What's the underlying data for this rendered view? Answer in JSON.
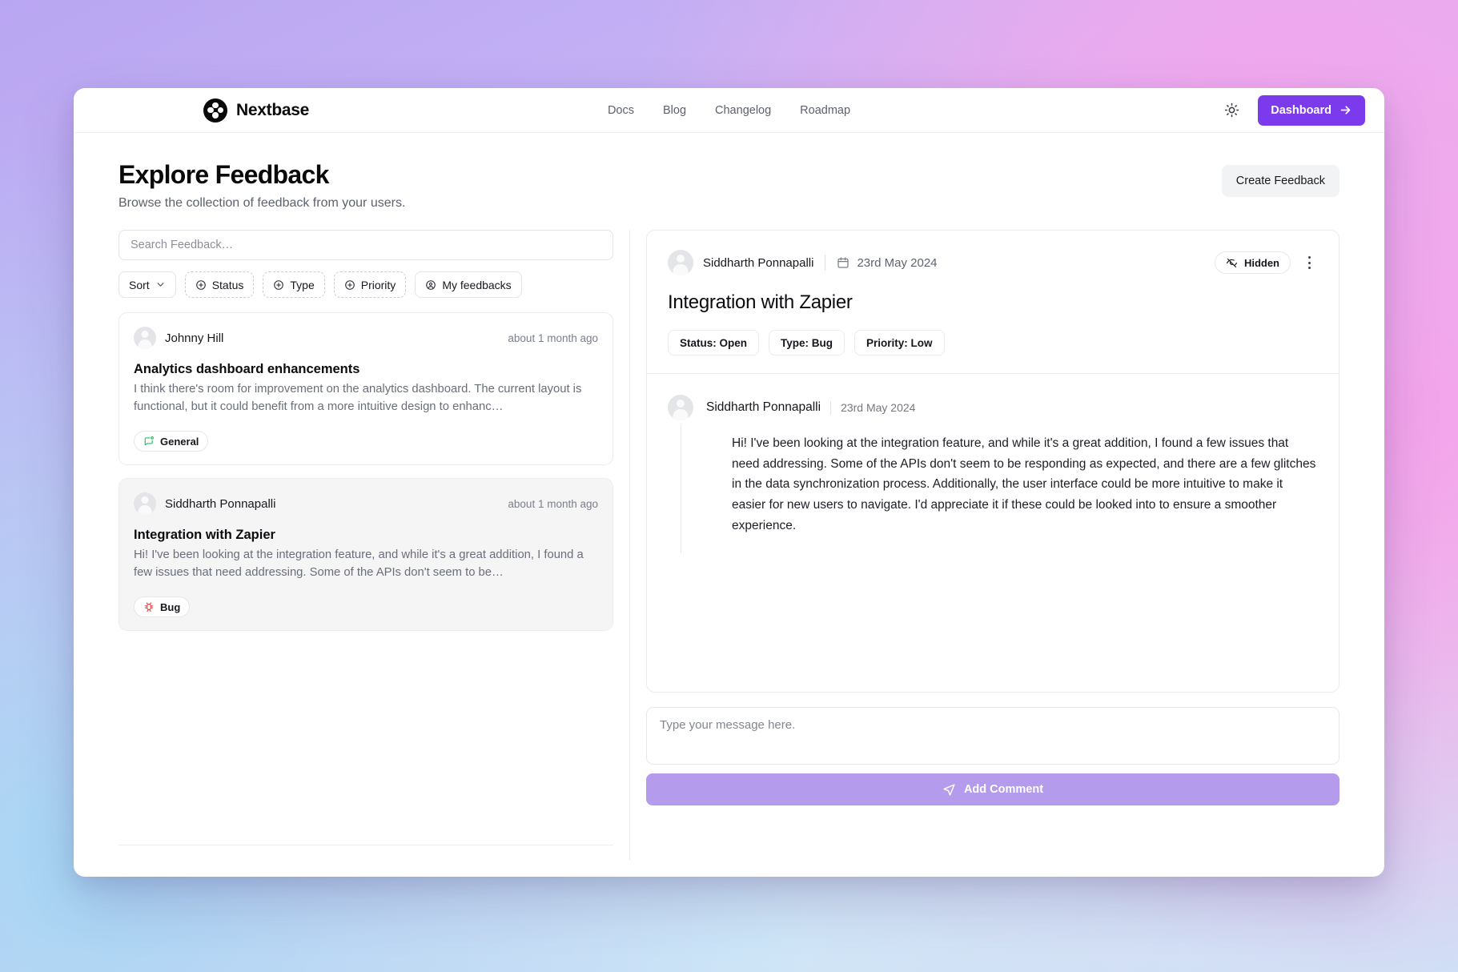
{
  "nav": {
    "brand": "Nextbase",
    "logo_icon": "nextbase-clover-logo",
    "links": [
      {
        "label": "Docs"
      },
      {
        "label": "Blog"
      },
      {
        "label": "Changelog"
      },
      {
        "label": "Roadmap"
      }
    ],
    "theme_toggle_icon": "sun-icon",
    "dashboard_label": "Dashboard",
    "dashboard_icon": "arrow-right-icon",
    "accent_color": "#7c3aed"
  },
  "page": {
    "title": "Explore Feedback",
    "subtitle": "Browse the collection of feedback from your users.",
    "create_label": "Create Feedback"
  },
  "search": {
    "value": "",
    "placeholder": "Search Feedback…"
  },
  "filters": [
    {
      "label": "Sort",
      "icon": "chevron-down-icon",
      "style": "solid"
    },
    {
      "label": "Status",
      "icon": "plus-circle-icon",
      "style": "dashed"
    },
    {
      "label": "Type",
      "icon": "plus-circle-icon",
      "style": "dashed"
    },
    {
      "label": "Priority",
      "icon": "plus-circle-icon",
      "style": "dashed"
    },
    {
      "label": "My feedbacks",
      "icon": "user-circle-icon",
      "style": "solid"
    }
  ],
  "feedback_list": [
    {
      "author": "Johnny Hill",
      "timestamp": "about 1 month ago",
      "title": "Analytics dashboard enhancements",
      "excerpt": "I think there's room for improvement on the analytics dashboard. The current layout is functional, but it could benefit from a more intuitive design to enhanc…",
      "badge": "General",
      "badge_icon": "message-square-dot-icon",
      "badge_color": "#22c55e",
      "selected": false
    },
    {
      "author": "Siddharth Ponnapalli",
      "timestamp": "about 1 month ago",
      "title": "Integration with Zapier",
      "excerpt": "Hi! I've been looking at the integration feature, and while it's a great addition, I found a few issues that need addressing. Some of the APIs don't seem to be…",
      "badge": "Bug",
      "badge_icon": "bug-icon",
      "badge_color": "#ef4444",
      "selected": true
    }
  ],
  "detail": {
    "author": "Siddharth Ponnapalli",
    "date": "23rd May 2024",
    "date_icon": "calendar-icon",
    "visibility_label": "Hidden",
    "visibility_icon": "eye-off-icon",
    "menu_icon": "more-vertical-icon",
    "title": "Integration with Zapier",
    "tags": [
      {
        "label": "Status: Open"
      },
      {
        "label": "Type: Bug"
      },
      {
        "label": "Priority: Low"
      }
    ],
    "comments": [
      {
        "author": "Siddharth Ponnapalli",
        "date": "23rd May 2024",
        "text": "Hi! I've been looking at the integration feature, and while it's a great addition, I found a few issues that need addressing. Some of the APIs don't seem to be responding as expected, and there are a few glitches in the data synchronization process. Additionally, the user interface could be more intuitive to make it easier for new users to navigate. I'd appreciate it if these could be looked into to ensure a smoother experience."
      }
    ]
  },
  "composer": {
    "value": "",
    "placeholder": "Type your message here.",
    "submit_label": "Add Comment",
    "submit_icon": "send-icon",
    "submit_color": "#b49bec"
  }
}
